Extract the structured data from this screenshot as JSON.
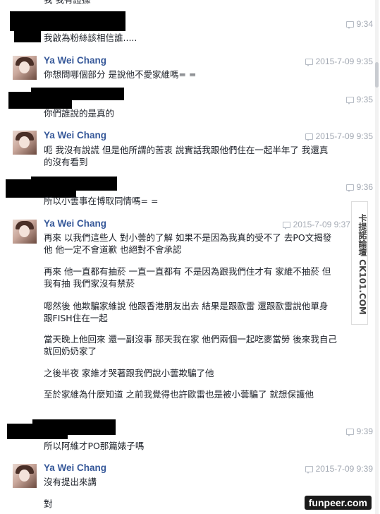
{
  "thread": {
    "top_fragment": "我 我有證據",
    "messages": [
      {
        "sender": "",
        "time": "9:34",
        "lines": [
          "我啟為粉絲該相信誰....."
        ]
      },
      {
        "sender": "Ya Wei Chang",
        "time": "2015-7-09 9:35",
        "lines": [
          "你想問哪個部分 是說他不愛家維嗎= ="
        ]
      },
      {
        "sender": "",
        "time": "9:35",
        "lines": [
          "你們誰說的是真的"
        ]
      },
      {
        "sender": "Ya Wei Chang",
        "time": "2015-7-09 9:35",
        "lines": [
          "呃 我沒有說謊 但是他所謂的苦衷 說實話我跟他們住在一起半年了 我還真的沒有看到"
        ]
      },
      {
        "sender": "",
        "time": "9:36",
        "lines": [
          "所以小蕓事在博取同情嗎= ="
        ]
      },
      {
        "sender": "Ya Wei Chang",
        "time": "2015-7-09 9:37",
        "lines": [
          "再來 以我們這些人 對小蕓的了解 如果不是因為我真的受不了 去PO文揭發他 他一定不會道歉 也絕對不會承認",
          "再來 他一直都有抽菸 一直一直都有 不是因為跟我們住才有 家維不抽菸 但我有抽 我們家沒有禁菸",
          "嗯然後 他欺騙家維說 他跟香港朋友出去 結果是跟歐雷 還跟歐雷說他單身 跟FISH住在一起",
          "當天晚上他回來 還一副沒事 那天我在家 他們兩個一起吃麥當勞 後來我自己就回奶奶家了",
          "之後半夜 家維才哭著跟我們說小蕓欺騙了他",
          "至於家維為什麼知道 之前我覺得也許歐雷也是被小蕓騙了 就想保護他"
        ]
      },
      {
        "sender": "",
        "time": "9:39",
        "lines": [
          "所以阿維才PO那篇婊子嗎"
        ]
      },
      {
        "sender": "Ya Wei Chang",
        "time": "2015-7-09 9:39",
        "lines": [
          "沒有提出來講",
          "對"
        ]
      }
    ]
  },
  "watermarks": {
    "side": "卡提諾論壇 CK101.COM",
    "bottom": "funpeer.com"
  },
  "colors": {
    "name_link": "#365899",
    "timestamp": "#a3a9b3",
    "redaction": "#000000"
  }
}
